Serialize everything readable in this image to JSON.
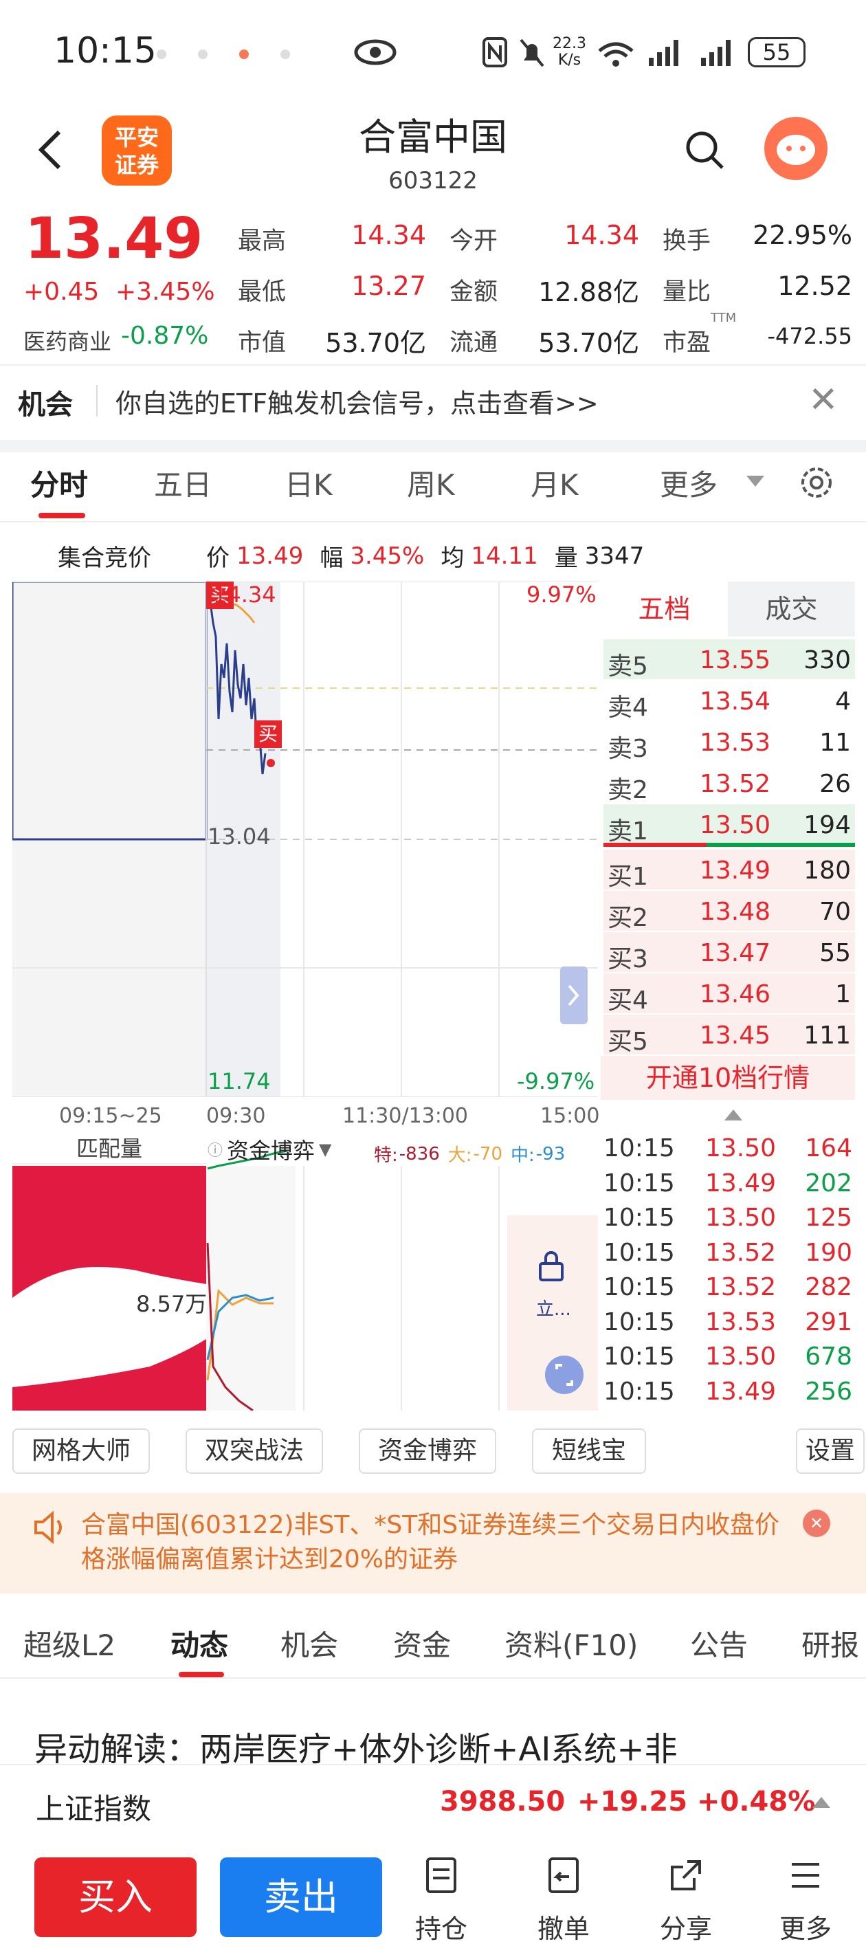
{
  "status_bar": {
    "time": "10:15",
    "net_speed_top": "22.3",
    "net_speed_bottom": "K/s",
    "signal_label": "6",
    "battery": "55"
  },
  "header": {
    "brand_line1": "平安",
    "brand_line2": "证券",
    "stock_name": "合富中国",
    "stock_code": "603122"
  },
  "quote": {
    "price": "13.49",
    "change": "+0.45",
    "change_pct": "+3.45%",
    "sector_label": "医药商业",
    "sector_change": "-0.87%",
    "high_label": "最高",
    "high": "14.34",
    "open_label": "今开",
    "open": "14.34",
    "turnover_label": "换手",
    "turnover": "22.95%",
    "low_label": "最低",
    "low": "13.27",
    "amount_label": "金额",
    "amount": "12.88亿",
    "vol_ratio_label": "量比",
    "vol_ratio": "12.52",
    "mcap_label": "市值",
    "mcap": "53.70亿",
    "float_label": "流通",
    "float_cap": "53.70亿",
    "pe_label": "市盈",
    "pe_sup": "TTM",
    "pe": "-472.55"
  },
  "opportunity": {
    "label": "机会",
    "text": "你自选的ETF触发机会信号，点击查看>>",
    "close": "✕"
  },
  "period_tabs": [
    "分时",
    "五日",
    "日K",
    "周K",
    "月K",
    "更多"
  ],
  "chart_info": {
    "mode": "集合竞价",
    "price_label": "价",
    "price": "13.49",
    "amp_label": "幅",
    "amp": "3.45%",
    "avg_label": "均",
    "avg": "14.11",
    "vol_label": "量",
    "vol": "3347"
  },
  "chart": {
    "top_price": "14.34",
    "mid_price": "13.04",
    "bottom_price": "11.74",
    "top_pct": "9.97%",
    "bottom_pct": "-9.97%",
    "buy_marker": "买",
    "time_axis": [
      "09:15~25",
      "09:30",
      "11:30/13:00",
      "15:00"
    ]
  },
  "orderbook": {
    "tab_active": "五档",
    "tab_other": "成交",
    "asks": [
      {
        "label": "卖5",
        "price": "13.55",
        "vol": "330"
      },
      {
        "label": "卖4",
        "price": "13.54",
        "vol": "4"
      },
      {
        "label": "卖3",
        "price": "13.53",
        "vol": "11"
      },
      {
        "label": "卖2",
        "price": "13.52",
        "vol": "26"
      },
      {
        "label": "卖1",
        "price": "13.50",
        "vol": "194"
      }
    ],
    "bids": [
      {
        "label": "买1",
        "price": "13.49",
        "vol": "180"
      },
      {
        "label": "买2",
        "price": "13.48",
        "vol": "70"
      },
      {
        "label": "买3",
        "price": "13.47",
        "vol": "55"
      },
      {
        "label": "买4",
        "price": "13.46",
        "vol": "1"
      },
      {
        "label": "买5",
        "price": "13.45",
        "vol": "111"
      }
    ],
    "open_level10": "开通10档行情"
  },
  "lower": {
    "match_label": "匹配量",
    "match_value": "8.57万",
    "fund_label": "资金博弈",
    "te_label": "特:",
    "te_val": "-836",
    "da_label": "大:",
    "da_val": "-70",
    "zhong_label": "中:",
    "zhong_val": "-93",
    "lock_text": "立..."
  },
  "ticks": [
    {
      "time": "10:15",
      "price": "13.50",
      "vol": "164",
      "side": "sell"
    },
    {
      "time": "10:15",
      "price": "13.49",
      "vol": "202",
      "side": "buy"
    },
    {
      "time": "10:15",
      "price": "13.50",
      "vol": "125",
      "side": "sell"
    },
    {
      "time": "10:15",
      "price": "13.52",
      "vol": "190",
      "side": "sell"
    },
    {
      "time": "10:15",
      "price": "13.52",
      "vol": "282",
      "side": "sell"
    },
    {
      "time": "10:15",
      "price": "13.53",
      "vol": "291",
      "side": "sell"
    },
    {
      "time": "10:15",
      "price": "13.50",
      "vol": "678",
      "side": "buy"
    },
    {
      "time": "10:15",
      "price": "13.49",
      "vol": "256",
      "side": "buy"
    }
  ],
  "tools": [
    "网格大师",
    "双突战法",
    "资金博弈",
    "短线宝",
    "设置"
  ],
  "notice": {
    "text": "合富中国(603122)非ST、*ST和S证券连续三个交易日内收盘价格涨幅偏离值累计达到20%的证券",
    "close": "✕"
  },
  "news_tabs": [
    "超级L2",
    "动态",
    "机会",
    "资金",
    "资料(F10)",
    "公告",
    "研报"
  ],
  "news_headline": "异动解读：两岸医疗+体外诊断+AI系统+非",
  "index_bar": {
    "name": "上证指数",
    "value": "3988.50",
    "change": "+19.25",
    "change_pct": "+0.48%"
  },
  "bottom_nav": {
    "buy": "买入",
    "sell": "卖出",
    "items": [
      "持仓",
      "撤单",
      "分享",
      "更多"
    ]
  },
  "colors": {
    "up": "#e8242b",
    "down": "#0b9f4a",
    "accent": "#e8242b",
    "sell_button": "#1a7ef0"
  }
}
